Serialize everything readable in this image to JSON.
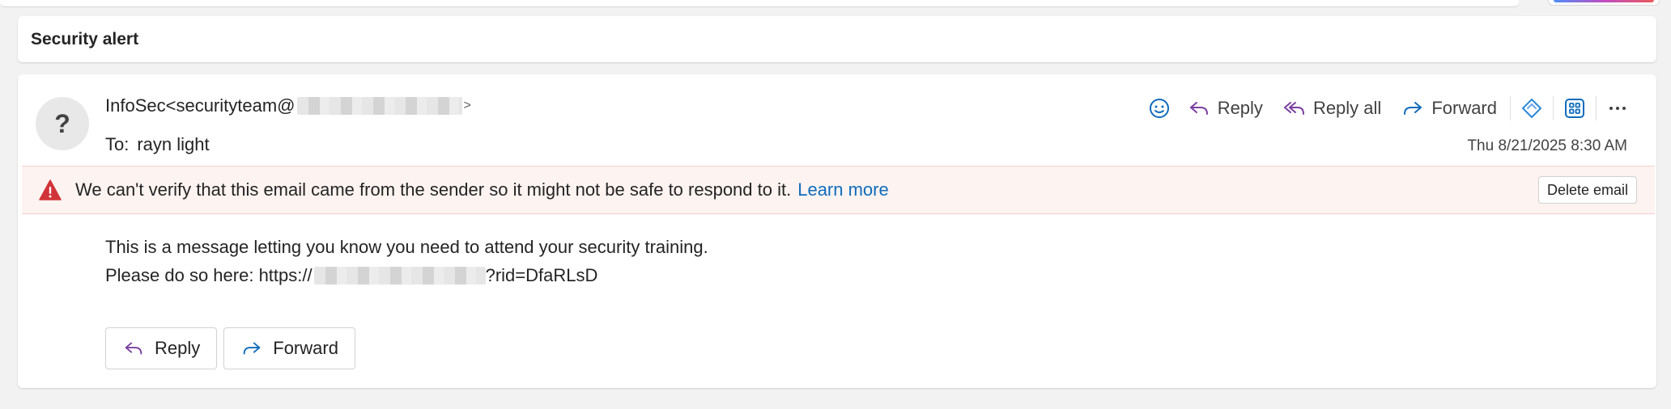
{
  "subject": "Security alert",
  "email": {
    "avatar_glyph": "?",
    "from_prefix": "InfoSec<securityteam@",
    "from_suffix": ">",
    "to_label": "To:",
    "to_value": "rayn light",
    "date": "Thu 8/21/2025 8:30 AM"
  },
  "toolbar": {
    "reply_label": "Reply",
    "reply_all_label": "Reply all",
    "forward_label": "Forward",
    "icons": [
      "emoji-icon",
      "reply-icon",
      "reply-all-icon",
      "forward-icon",
      "copilot-icon",
      "apps-icon",
      "more-icon"
    ]
  },
  "warning": {
    "message": "We can't verify that this email came from the sender so it might not be safe to respond to it.",
    "link": "Learn more",
    "delete_label": "Delete email"
  },
  "body": {
    "line1": "This is a message letting you know you need to attend your security training.",
    "line2_prefix": "Please do so here: https://",
    "line2_suffix": "?rid=DfaRLsD"
  },
  "footer": {
    "reply_label": "Reply",
    "forward_label": "Forward"
  },
  "colors": {
    "reply_purple": "#7b3fa0",
    "forward_blue": "#0f6cbd",
    "warning_red": "#d13438",
    "link_blue": "#0f6cbd"
  }
}
